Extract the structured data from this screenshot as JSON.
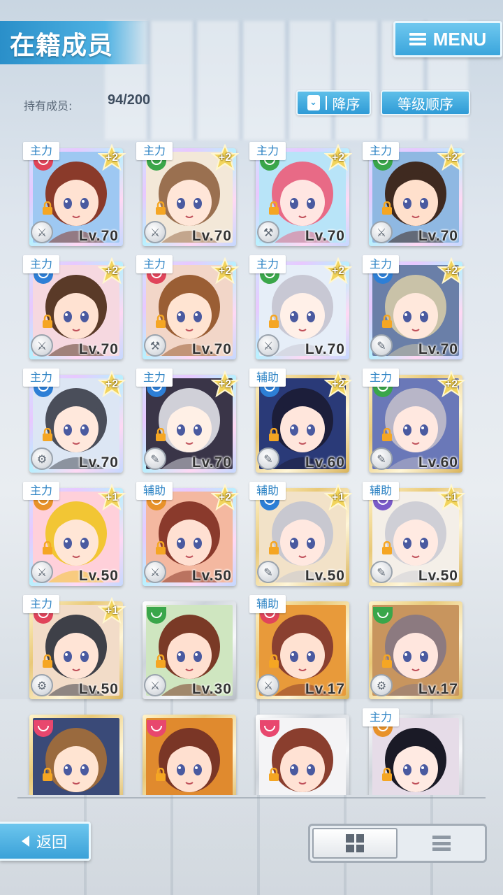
{
  "header": {
    "title": "在籍成员",
    "menu_label": "MENU"
  },
  "members": {
    "count_label": "持有成员:",
    "count_value": "94/200"
  },
  "sort": {
    "direction_label": "降序",
    "order_label": "等级顺序"
  },
  "colors": {
    "accent": "#3aa5dc",
    "tag_text": "#2d83c4",
    "red_emblem": "#e0445a",
    "green_emblem": "#3aa64a",
    "blue_emblem": "#2d7fd6",
    "orange_emblem": "#e8922a",
    "purple_emblem": "#7a5ac8",
    "pink_emblem": "#e8476e"
  },
  "cards": [
    {
      "role": "主力",
      "emblem": "#e0445a",
      "star": "+2",
      "level": "Lv.70",
      "frame": "rainbow",
      "hair": "#8a3a2a",
      "skin": "#ffe2d2",
      "bg": "#9ec8f2",
      "type": "sword"
    },
    {
      "role": "主力",
      "emblem": "#3aa64a",
      "star": "+2",
      "level": "Lv.70",
      "frame": "rainbow",
      "hair": "#9a7050",
      "skin": "#ffe6d8",
      "bg": "#f3e8d8",
      "type": "sword"
    },
    {
      "role": "主力",
      "emblem": "#3aa64a",
      "star": "+2",
      "level": "Lv.70",
      "frame": "rainbow",
      "hair": "#e86a86",
      "skin": "#ffe6e2",
      "bg": "#b8e4f8",
      "type": "hammer"
    },
    {
      "role": "主力",
      "emblem": "#3aa64a",
      "star": "+2",
      "level": "Lv.70",
      "frame": "rainbow",
      "hair": "#3f2a20",
      "skin": "#ffe0cc",
      "bg": "#8fb8e2",
      "type": "sword"
    },
    {
      "role": "主力",
      "emblem": "#2d7fd6",
      "star": "+2",
      "level": "Lv.70",
      "frame": "rainbow",
      "hair": "#5a3a28",
      "skin": "#ffe2d2",
      "bg": "#f6d8e0",
      "type": "sword"
    },
    {
      "role": "主力",
      "emblem": "#e0445a",
      "star": "+2",
      "level": "Lv.70",
      "frame": "rainbow",
      "hair": "#9a5e34",
      "skin": "#ffe4d2",
      "bg": "#f2d6c8",
      "type": "hammer"
    },
    {
      "role": "主力",
      "emblem": "#3aa64a",
      "star": "+2",
      "level": "Lv.70",
      "frame": "rainbow",
      "hair": "#c8c8d4",
      "skin": "#fff0e8",
      "bg": "#e6eef8",
      "type": "sword"
    },
    {
      "role": "主力",
      "emblem": "#2d7fd6",
      "star": "+2",
      "level": "Lv.70",
      "frame": "rainbow",
      "hair": "#c9c2a8",
      "skin": "#ffe8dc",
      "bg": "#6a7fa8",
      "type": "wrench"
    },
    {
      "role": "主力",
      "emblem": "#2d7fd6",
      "star": "+2",
      "level": "Lv.70",
      "frame": "rainbow",
      "hair": "#4a4e5a",
      "skin": "#ffe8dc",
      "bg": "#dce6f4",
      "type": "gear"
    },
    {
      "role": "主力",
      "emblem": "#2d7fd6",
      "star": "+2",
      "level": "Lv.70",
      "frame": "rainbow",
      "hair": "#d0d0d8",
      "skin": "#fff0e6",
      "bg": "#3a3548",
      "type": "wrench"
    },
    {
      "role": "辅助",
      "emblem": "#2d7fd6",
      "star": "+2",
      "level": "Lv.60",
      "frame": "gold",
      "hair": "#1c1e3a",
      "skin": "#ffe6dc",
      "bg": "#2a3a78",
      "type": "wrench"
    },
    {
      "role": "主力",
      "emblem": "#3aa64a",
      "star": "+2",
      "level": "Lv.60",
      "frame": "gold",
      "hair": "#b8b6c8",
      "skin": "#ffe8e0",
      "bg": "#6a78b8",
      "type": "wrench"
    },
    {
      "role": "主力",
      "emblem": "#e8922a",
      "star": "+1",
      "level": "Lv.50",
      "frame": "rainbow",
      "hair": "#f2c634",
      "skin": "#ffe6d6",
      "bg": "#ffd0da",
      "type": "sword"
    },
    {
      "role": "辅助",
      "emblem": "#e8922a",
      "star": "+2",
      "level": "Lv.50",
      "frame": "rainbow",
      "hair": "#8a3a2c",
      "skin": "#ffe0d2",
      "bg": "#f4b8a0",
      "type": "sword"
    },
    {
      "role": "辅助",
      "emblem": "#2d7fd6",
      "star": "+1",
      "level": "Lv.50",
      "frame": "gold",
      "hair": "#c8c8d0",
      "skin": "#ffe8e0",
      "bg": "#f2e2c8",
      "type": "wrench"
    },
    {
      "role": "辅助",
      "emblem": "#7a5ac8",
      "star": "+1",
      "level": "Lv.50",
      "frame": "gold",
      "hair": "#cfcfd6",
      "skin": "#ffeae2",
      "bg": "#f4efe8",
      "type": "wrench"
    },
    {
      "role": "主力",
      "emblem": "#e0445a",
      "star": "+1",
      "level": "Lv.50",
      "frame": "gold",
      "hair": "#3e4048",
      "skin": "#ffe4d6",
      "bg": "#f2dcc8",
      "type": "gear"
    },
    {
      "role": "",
      "emblem": "#3aa64a",
      "star": "",
      "level": "Lv.30",
      "frame": "silver",
      "hair": "#7a3a26",
      "skin": "#ffe0d0",
      "bg": "#cfe6c0",
      "type": "sword"
    },
    {
      "role": "辅助",
      "emblem": "#e0445a",
      "star": "",
      "level": "Lv.17",
      "frame": "gold",
      "hair": "#8a4030",
      "skin": "#ffe2d2",
      "bg": "#e89a3a",
      "type": "sword"
    },
    {
      "role": "",
      "emblem": "#3aa64a",
      "star": "",
      "level": "Lv.17",
      "frame": "gold",
      "hair": "#8c7a80",
      "skin": "#ffe6de",
      "bg": "#c8955e",
      "type": "gear"
    },
    {
      "role": "",
      "emblem": "#e8476e",
      "star": "",
      "level": "",
      "frame": "gold",
      "hair": "#9a6a3e",
      "skin": "#ffe4d2",
      "bg": "#3a4a78",
      "type": ""
    },
    {
      "role": "",
      "emblem": "#e8476e",
      "star": "",
      "level": "",
      "frame": "gold",
      "hair": "#7a3626",
      "skin": "#ffe0d0",
      "bg": "#e08a2e",
      "type": ""
    },
    {
      "role": "",
      "emblem": "#e8476e",
      "star": "",
      "level": "",
      "frame": "silver",
      "hair": "#8a3e2e",
      "skin": "#ffe2d4",
      "bg": "#f4f4f6",
      "type": ""
    },
    {
      "role": "主力",
      "emblem": "#e8922a",
      "star": "",
      "level": "",
      "frame": "silver",
      "hair": "#1a1a26",
      "skin": "#ffeae2",
      "bg": "#e6dce8",
      "type": ""
    }
  ],
  "footer": {
    "back_label": "返回"
  }
}
